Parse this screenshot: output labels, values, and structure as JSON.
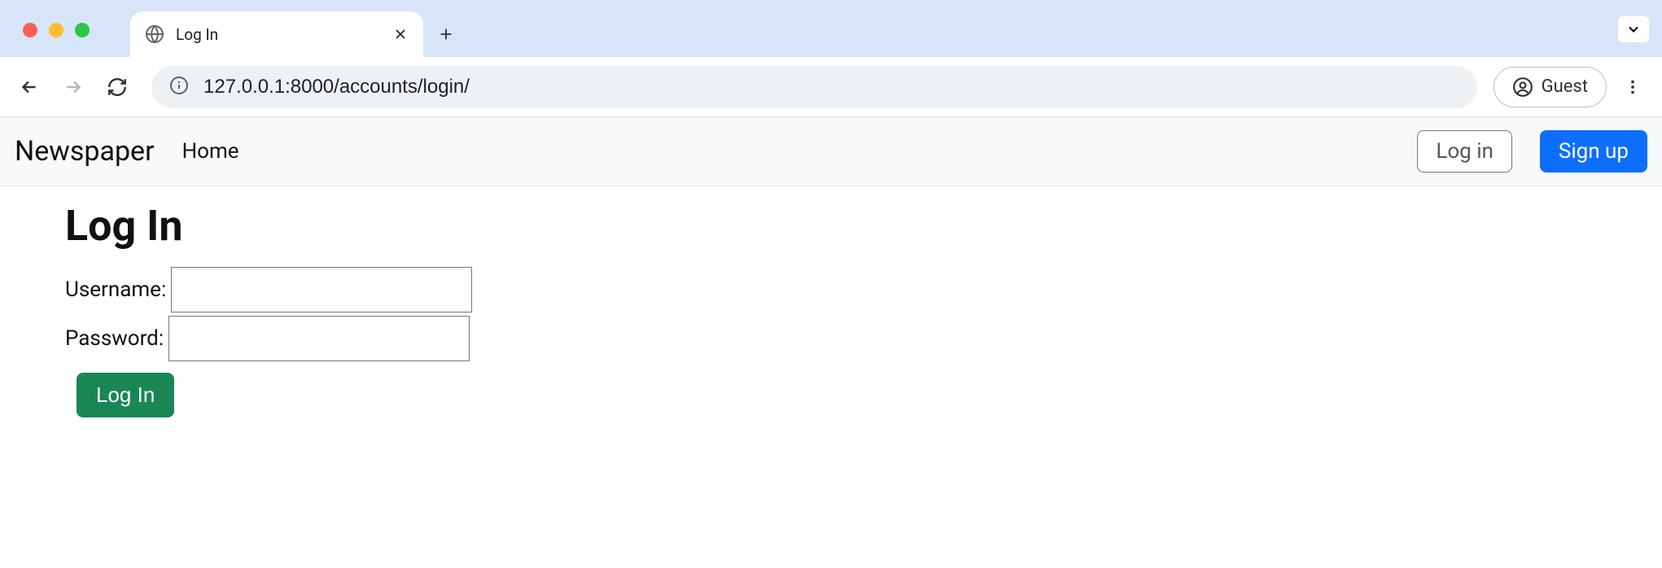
{
  "browser": {
    "tab_title": "Log In",
    "url": "127.0.0.1:8000/accounts/login/",
    "profile_label": "Guest"
  },
  "site_nav": {
    "brand": "Newspaper",
    "home_label": "Home",
    "login_label": "Log in",
    "signup_label": "Sign up"
  },
  "page": {
    "heading": "Log In",
    "username_label": "Username:",
    "password_label": "Password:",
    "submit_label": "Log In"
  }
}
